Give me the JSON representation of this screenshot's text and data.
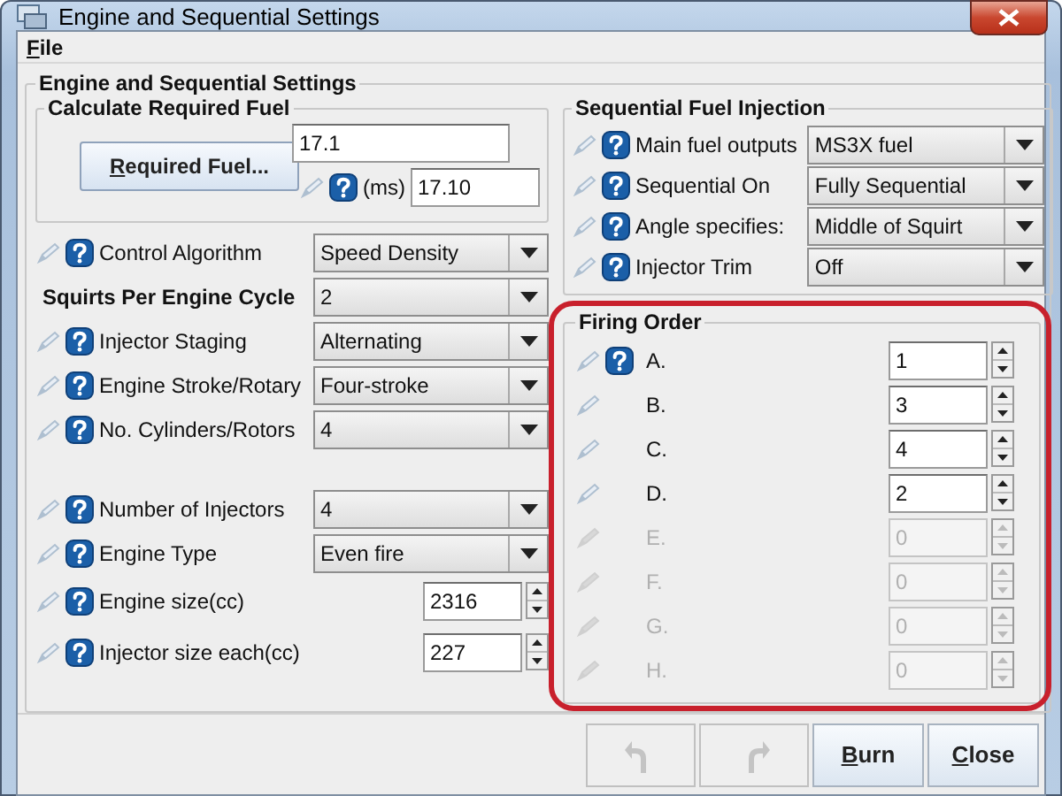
{
  "window": {
    "title": "Engine and Sequential Settings"
  },
  "menu": [
    {
      "label": "File",
      "mnemonic": true
    }
  ],
  "main_group": {
    "title": "Engine and Sequential Settings"
  },
  "required_fuel": {
    "title": "Calculate Required Fuel",
    "button": {
      "label": "Required Fuel...",
      "mnemonic": true
    },
    "value": "17.1",
    "unit": "(ms)",
    "ms_value": "17.10"
  },
  "engine_rows": [
    {
      "kind": "select",
      "label": "Control Algorithm",
      "value": "Speed Density"
    },
    {
      "kind": "heading-select",
      "label": "Squirts Per Engine Cycle",
      "value": "2"
    },
    {
      "kind": "select",
      "label": "Injector Staging",
      "value": "Alternating"
    },
    {
      "kind": "select",
      "label": "Engine Stroke/Rotary",
      "value": "Four-stroke"
    },
    {
      "kind": "select",
      "label": "No. Cylinders/Rotors",
      "value": "4"
    },
    {
      "kind": "spacer"
    },
    {
      "kind": "select",
      "label": "Number of Injectors",
      "value": "4"
    },
    {
      "kind": "select",
      "label": "Engine Type",
      "value": "Even fire"
    },
    {
      "kind": "spinner",
      "label": "Engine size(cc)",
      "value": "2316"
    },
    {
      "kind": "spinner",
      "label": "Injector size each(cc)",
      "value": "227"
    }
  ],
  "sequential": {
    "title": "Sequential Fuel Injection",
    "rows": [
      {
        "label": "Main fuel outputs",
        "value": "MS3X fuel"
      },
      {
        "label": "Sequential On",
        "value": "Fully Sequential"
      },
      {
        "label": "Angle specifies:",
        "value": "Middle of Squirt"
      },
      {
        "label": "Injector Trim",
        "value": "Off"
      }
    ]
  },
  "firing_order": {
    "title": "Firing Order",
    "highlighted": true,
    "rows": [
      {
        "label": "A.",
        "value": "1",
        "disabled": false,
        "help": true
      },
      {
        "label": "B.",
        "value": "3",
        "disabled": false,
        "help": false
      },
      {
        "label": "C.",
        "value": "4",
        "disabled": false,
        "help": false
      },
      {
        "label": "D.",
        "value": "2",
        "disabled": false,
        "help": false
      },
      {
        "label": "E.",
        "value": "0",
        "disabled": true,
        "help": false
      },
      {
        "label": "F.",
        "value": "0",
        "disabled": true,
        "help": false
      },
      {
        "label": "G.",
        "value": "0",
        "disabled": true,
        "help": false
      },
      {
        "label": "H.",
        "value": "0",
        "disabled": true,
        "help": false
      }
    ]
  },
  "footer": {
    "buttons": [
      {
        "kind": "undo",
        "disabled": true
      },
      {
        "kind": "redo",
        "disabled": true
      },
      {
        "kind": "text",
        "label": "Burn",
        "mnemonic": true,
        "disabled": false
      },
      {
        "kind": "text",
        "label": "Close",
        "mnemonic": true,
        "disabled": false
      }
    ]
  }
}
